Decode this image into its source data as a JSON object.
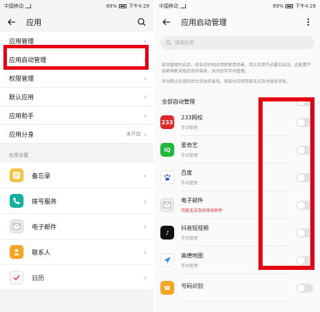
{
  "left": {
    "status": {
      "carrier": "中国移动",
      "battery": "89%",
      "time": "下午4:29"
    },
    "title": "应用",
    "rows": [
      {
        "label": "应用管理",
        "value": ""
      },
      {
        "label": "应用启动管理",
        "value": ""
      },
      {
        "label": "权限管理",
        "value": ""
      },
      {
        "label": "默认应用",
        "value": ""
      },
      {
        "label": "应用助手",
        "value": ""
      },
      {
        "label": "应用分身",
        "value": "未开启"
      }
    ],
    "section": "应用设置",
    "apps": [
      {
        "name": "备忘录",
        "icon": "memo-icon",
        "color": "#f6c343"
      },
      {
        "name": "拨号服务",
        "icon": "phone-icon",
        "color": "#13b1a4"
      },
      {
        "name": "电子邮件",
        "icon": "mail-icon",
        "color": "#e8e8ee"
      },
      {
        "name": "联系人",
        "icon": "contacts-icon",
        "color": "#f5a623"
      },
      {
        "name": "日历",
        "icon": "calendar-icon",
        "color": "#f7f7f7"
      }
    ]
  },
  "right": {
    "status": {
      "carrier": "中国移动",
      "battery": "89%",
      "time": "下午4:29"
    },
    "title": "应用启动管理",
    "search_placeholder": "搜索应用",
    "description": "自动管理开启后，将自动识别应用和使用场景，禁止应用不必要的启动。此配置不会影响新消息的及时接收。关闭后可手动管理。",
    "description2": "手动禁止应用的后台活动可省电，但部分应用可能无法及时接收消息。",
    "all_label": "全部自动管理",
    "apps": [
      {
        "name": "233网校",
        "status": "手动管理",
        "warn": false,
        "icon": "233-icon",
        "color": "#e02828",
        "glyph": "233"
      },
      {
        "name": "爱奇艺",
        "status": "手动管理",
        "warn": false,
        "icon": "iqiyi-icon",
        "color": "#1fb93b",
        "glyph": "iQ"
      },
      {
        "name": "百度",
        "status": "手动管理",
        "warn": false,
        "icon": "baidu-icon",
        "color": "#ffffff",
        "glyph": "du"
      },
      {
        "name": "电子邮件",
        "status": "可能无法及时接收邮件",
        "warn": true,
        "icon": "mail-icon",
        "color": "#ececf0",
        "glyph": "✉"
      },
      {
        "name": "抖音短视频",
        "status": "手动管理",
        "warn": false,
        "icon": "douyin-icon",
        "color": "#111111",
        "glyph": "♪"
      },
      {
        "name": "高德地图",
        "status": "手动管理",
        "warn": false,
        "icon": "amap-icon",
        "color": "#ffffff",
        "glyph": "➤"
      },
      {
        "name": "号码识别",
        "status": "",
        "warn": false,
        "icon": "number-id-icon",
        "color": "#f5a623",
        "glyph": "☎"
      }
    ]
  }
}
